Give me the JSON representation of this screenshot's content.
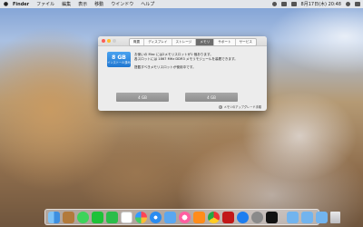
{
  "menubar": {
    "app_name": "Finder",
    "items": [
      "ファイル",
      "編集",
      "表示",
      "移動",
      "ウインドウ",
      "ヘルプ"
    ],
    "clock": "8月17日(木) 20:48"
  },
  "about_window": {
    "tabs": [
      "概要",
      "ディスプレイ",
      "ストレージ",
      "メモリ",
      "サポート",
      "サービス"
    ],
    "active_tab": "メモリ",
    "memory_size": "8 GB",
    "memory_sublabel": "インストール済み",
    "description_lines": [
      "お使いの Mac には2メモリスロットが1 個あります。",
      "各スロットには 1867 MHz DDR3 メモリモジュールを装着できます。"
    ],
    "note": "搭載すべきメモリスロットが使用中です。",
    "slots": [
      "4 GB",
      "4 GB"
    ],
    "upgrade_link": "メモリのアップグレード手順"
  },
  "dock": {
    "apps": [
      "finder",
      "contacts",
      "messages",
      "line",
      "facetime",
      "calendar",
      "photos",
      "safari",
      "mail",
      "itunes",
      "ibooks",
      "chrome",
      "dvd-player",
      "app-store",
      "system-preferences",
      "activity-monitor"
    ],
    "stack_folders": [
      "documents-folder",
      "downloads-folder",
      "folder"
    ],
    "trash": "trash"
  }
}
